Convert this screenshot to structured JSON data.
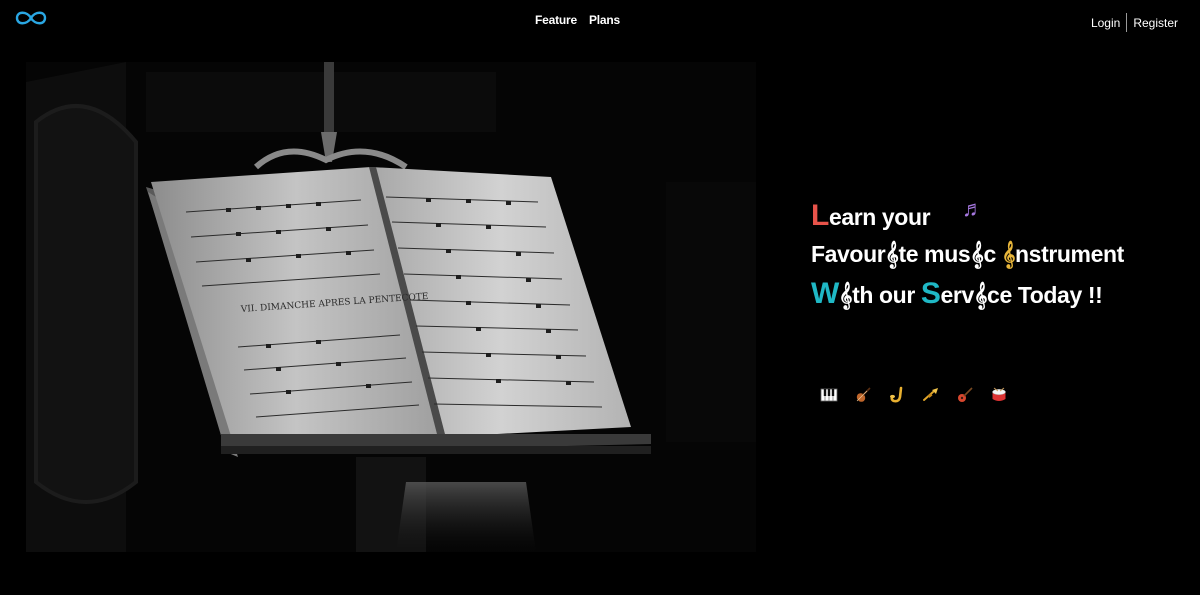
{
  "nav": {
    "links": [
      "Feature",
      "Plans"
    ],
    "login_label": "Login",
    "register_label": "Register"
  },
  "logo": {
    "icon": "infinity-icon",
    "color": "#2aa7e3"
  },
  "tagline": {
    "line1_cap": "L",
    "line1_rest": "earn your",
    "line2_part1": "Favour",
    "line2_clef1": "𝄞",
    "line2_part2": "te mus",
    "line2_clef2": "𝄞",
    "line2_part3": "c ",
    "line2_clef3": "𝄞",
    "line2_part4": "nstrument",
    "line3_cap1": "W",
    "line3_clef1": "𝄞",
    "line3_part1": "th our ",
    "line3_cap2": "S",
    "line3_part2": "erv",
    "line3_clef2": "𝄞",
    "line3_part3": "ce Today !!",
    "note_glyph": "♬",
    "accent_red": "#e8534a",
    "accent_teal": "#1fb8c5",
    "accent_gold": "#e8b63a"
  },
  "hero_image": {
    "book_text": "VII. DIMANCHE APRES LA PENTECOTE"
  },
  "instruments": [
    "piano-icon",
    "violin-icon",
    "saxophone-icon",
    "trumpet-icon",
    "guitar-icon",
    "drum-icon"
  ]
}
